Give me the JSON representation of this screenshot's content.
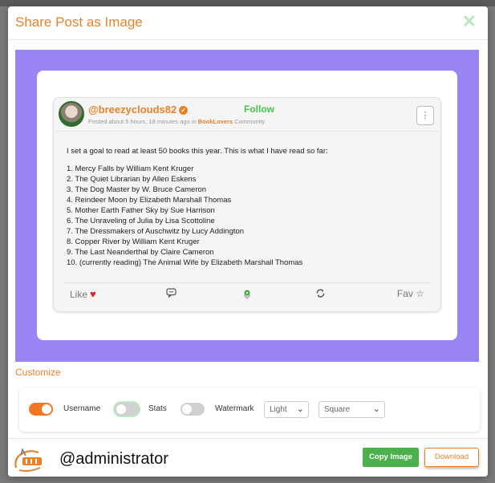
{
  "modal": {
    "title": "Share Post as Image",
    "close_icon": "close-x-icon"
  },
  "post": {
    "username": "@breezyclouds82",
    "follow_label": "Follow",
    "posted_prefix": "Posted about 5 hours, 18 minutes ago in",
    "community_name": "BookLovers",
    "community_suffix": "Community",
    "more_icon": "vertical-dots-icon",
    "intro": "I set a goal to read at least 50 books this year. This is what I have read so far:",
    "books": [
      "1. Mercy Falls by William Kent Kruger",
      "2. The Quiet Librarian by Allen Eskens",
      "3. The Dog Master by W. Bruce Cameron",
      "4. Reindeer Moon by Elizabeth Marshall Thomas",
      "5. Mother Earth Father Sky by Sue Harrison",
      "6. The Unraveling of Julia by Lisa Scottoline",
      "7. The Dressmakers of Auschwitz by Lucy Addington",
      "8. Copper River by William Kent Kruger",
      "9. The Last Neanderthal by Claire Cameron",
      "10. (currently reading) The Animal Wife by Elizabeth Marshall Thomas"
    ],
    "footer": {
      "like_label": "Like",
      "fav_label": "Fav"
    }
  },
  "customize": {
    "heading": "Customize",
    "username_label": "Username",
    "username_on": true,
    "stats_label": "Stats",
    "stats_on": false,
    "watermark_label": "Watermark",
    "watermark_on": false,
    "theme_value": "Light",
    "shape_value": "Square"
  },
  "footer": {
    "admin_name": "@administrator",
    "copy_label": "Copy Image",
    "download_label": "Download"
  },
  "colors": {
    "accent": "#e8822a",
    "follow": "#4cc24c",
    "preview_bg": "#9b85f5",
    "copy_button": "#4cb14c"
  }
}
